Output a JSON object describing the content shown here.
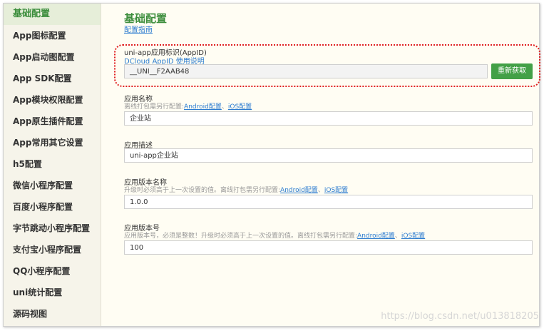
{
  "sidebar": {
    "items": [
      {
        "label": "基础配置"
      },
      {
        "label": "App图标配置"
      },
      {
        "label": "App启动图配置"
      },
      {
        "label": "App SDK配置"
      },
      {
        "label": "App模块权限配置"
      },
      {
        "label": "App原生插件配置"
      },
      {
        "label": "App常用其它设置"
      },
      {
        "label": "h5配置"
      },
      {
        "label": "微信小程序配置"
      },
      {
        "label": "百度小程序配置"
      },
      {
        "label": "字节跳动小程序配置"
      },
      {
        "label": "支付宝小程序配置"
      },
      {
        "label": "QQ小程序配置"
      },
      {
        "label": "uni统计配置"
      },
      {
        "label": "源码视图"
      }
    ]
  },
  "main": {
    "title": "基础配置",
    "guide_link": "配置指南",
    "appid": {
      "label": "uni-app应用标识(AppID)",
      "help_link": "DCloud AppID 使用说明",
      "value": "__UNI__F2AAB48",
      "refresh_button": "重新获取"
    },
    "app_name": {
      "label": "应用名称",
      "hint_prefix": "离线打包需另行配置:",
      "android_link": "Android配置",
      "sep": "、",
      "ios_link": "iOS配置",
      "value": "企业站"
    },
    "app_desc": {
      "label": "应用描述",
      "value": "uni-app企业站"
    },
    "version_name": {
      "label": "应用版本名称",
      "hint_prefix": "升级时必须高于上一次设置的值。离线打包需另行配置:",
      "android_link": "Android配置",
      "sep": "、",
      "ios_link": "iOS配置",
      "value": "1.0.0"
    },
    "version_code": {
      "label": "应用版本号",
      "hint_prefix": "应用版本号，必须是整数！升级时必须高于上一次设置的值。离线打包需另行配置:",
      "android_link": "Android配置",
      "sep": "、",
      "ios_link": "iOS配置",
      "value": "100"
    }
  },
  "watermark": "https://blog.csdn.net/u013818205",
  "colors": {
    "accent_green": "#3d8e3d",
    "button_green": "#43a047",
    "link_blue": "#2c7cd0",
    "highlight_red": "#e02020"
  }
}
